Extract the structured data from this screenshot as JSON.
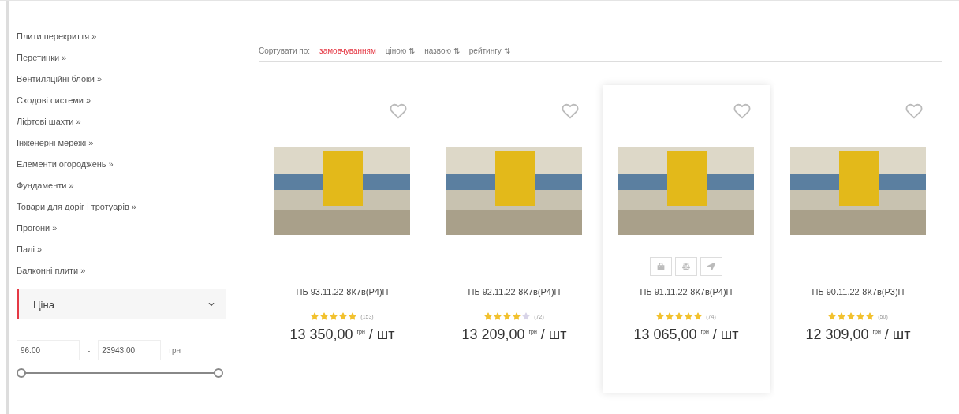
{
  "categories": [
    {
      "label": "Плити перекриття »"
    },
    {
      "label": "Перетинки »"
    },
    {
      "label": "Вентиляційні блоки »"
    },
    {
      "label": "Сходові системи »"
    },
    {
      "label": "Ліфтові шахти »"
    },
    {
      "label": "Інженерні мережі »"
    },
    {
      "label": "Елементи огороджень »"
    },
    {
      "label": "Фундаменти »"
    },
    {
      "label": "Товари для доріг і тротуарів »"
    },
    {
      "label": "Прогони »"
    },
    {
      "label": "Палі »"
    },
    {
      "label": "Балконні плити »"
    }
  ],
  "price_filter": {
    "title": "Ціна",
    "expanded": true,
    "min": "96.00",
    "dash": "-",
    "max": "23943.00",
    "currency": "грн",
    "thumbs": [
      {
        "level": 0
      },
      {
        "level": 1
      }
    ]
  },
  "sort": {
    "label": "Сортувати по:",
    "options": [
      {
        "label": "замовчуванням",
        "selected": true
      },
      {
        "label": "ціною",
        "selected": false,
        "arrows": "⇅"
      },
      {
        "label": "назвою",
        "selected": false,
        "arrows": "⇅"
      },
      {
        "label": "рейтингу",
        "selected": false,
        "arrows": "⇅"
      }
    ]
  },
  "products": [
    {
      "name": "ПБ 93.11.22-8К7в(Р4)П",
      "stars": 5,
      "reviews": "(153)",
      "price": "13 350,00",
      "currency": "грн",
      "unit": "/ шт",
      "hovered": false
    },
    {
      "name": "ПБ 92.11.22-8К7в(Р4)П",
      "stars": 4,
      "reviews": "(72)",
      "price": "13 209,00",
      "currency": "грн",
      "unit": "/ шт",
      "hovered": false
    },
    {
      "name": "ПБ 91.11.22-8К7в(Р4)П",
      "stars": 5,
      "reviews": "(74)",
      "price": "13 065,00",
      "currency": "грн",
      "unit": "/ шт",
      "hovered": true
    },
    {
      "name": "ПБ 90.11.22-8К7в(Р3)П",
      "stars": 5,
      "reviews": "(50)",
      "price": "12 309,00",
      "currency": "грн",
      "unit": "/ шт",
      "hovered": false
    }
  ]
}
